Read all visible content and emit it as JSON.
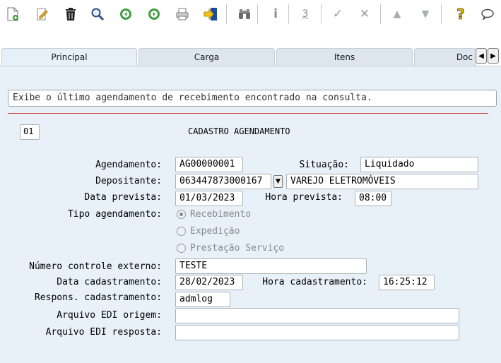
{
  "toolbar": {
    "icons": [
      "new-document-icon",
      "edit-icon",
      "delete-trash-icon",
      "search-icon",
      "previous-icon",
      "next-icon",
      "print-icon",
      "exit-icon",
      "binoculars-icon",
      "info-icon",
      "numbering-icon",
      "confirm-check-icon",
      "cancel-icon",
      "move-up-icon",
      "move-down-icon",
      "help-icon",
      "comment-icon"
    ],
    "glyphs": {
      "info": "i",
      "numbering": "3",
      "check": "✓",
      "cancel": "✕",
      "up": "▲",
      "down": "▼",
      "help": "?"
    }
  },
  "tabs": [
    {
      "label": "Principal",
      "active": true
    },
    {
      "label": "Carga",
      "active": false
    },
    {
      "label": "Itens",
      "active": false
    },
    {
      "label": "Doc",
      "active": false
    }
  ],
  "tab_nav": {
    "prev": "◀",
    "next": "▶"
  },
  "message": "Exibe o último agendamento de recebimento encontrado na consulta.",
  "form": {
    "code": "01",
    "title": "CADASTRO AGENDAMENTO",
    "agendamento": {
      "label": "Agendamento:",
      "value": "AG00000001"
    },
    "situacao": {
      "label": "Situação:",
      "value": "Liquidado"
    },
    "depositante": {
      "label": "Depositante:",
      "value": "063447873000167",
      "name": "VAREJO ELETROMÓVEIS",
      "dropdown_glyph": "▼"
    },
    "data_prevista": {
      "label": "Data prevista:",
      "value": "01/03/2023"
    },
    "hora_prevista": {
      "label": "Hora prevista:",
      "value": "08:00"
    },
    "tipo_agendamento": {
      "label": "Tipo agendamento:",
      "options": [
        "Recebimento",
        "Expedição",
        "Prestação Serviço"
      ],
      "selected": "Recebimento"
    },
    "numero_controle": {
      "label": "Número controle externo:",
      "value": "TESTE"
    },
    "data_cadastramento": {
      "label": "Data cadastramento:",
      "value": "28/02/2023"
    },
    "hora_cadastramento": {
      "label": "Hora cadastramento:",
      "value": "16:25:12"
    },
    "respons_cadastramento": {
      "label": "Respons. cadastramento:",
      "value": "admlog"
    },
    "arquivo_origem": {
      "label": "Arquivo EDI origem:",
      "value": ""
    },
    "arquivo_resposta": {
      "label": "Arquivo EDI resposta:",
      "value": ""
    }
  },
  "colors": {
    "panel_bg": "#e8f0f8",
    "tab_bg": "#dde6ee",
    "separator_red": "#d23b3b",
    "disabled_text": "#8a8a8a"
  }
}
